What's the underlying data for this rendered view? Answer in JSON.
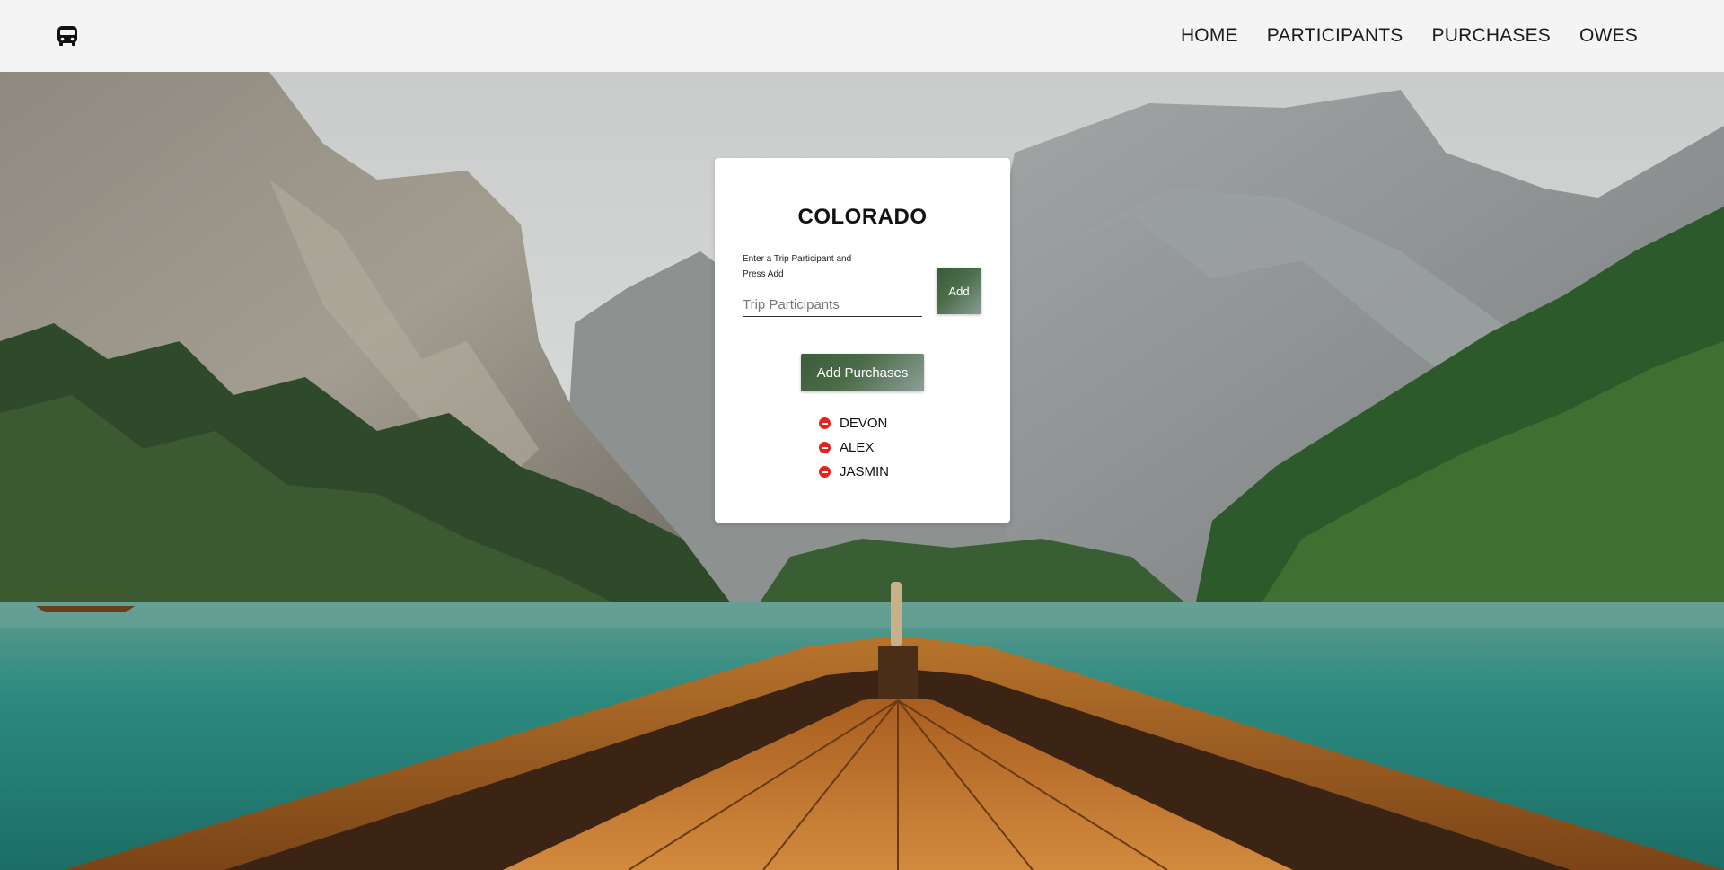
{
  "nav": {
    "brand_icon": "bus-icon",
    "links": [
      {
        "label": "HOME"
      },
      {
        "label": "PARTICIPANTS"
      },
      {
        "label": "PURCHASES"
      },
      {
        "label": "OWES"
      }
    ]
  },
  "card": {
    "title": "COLORADO",
    "helper_text": "Enter a Trip Participant and Press Add",
    "input_placeholder": "Trip Participants",
    "input_value": "",
    "add_label": "Add",
    "purchases_label": "Add Purchases",
    "remove_icon": "minus-circle-icon",
    "participants": [
      {
        "name": "DEVON"
      },
      {
        "name": "ALEX"
      },
      {
        "name": "JASMIN"
      }
    ]
  },
  "colors": {
    "navbar_bg": "#f4f4f4",
    "button_green": "#4c6e4a",
    "remove_red": "#e8231f",
    "lake_teal": "#2f8b80"
  }
}
